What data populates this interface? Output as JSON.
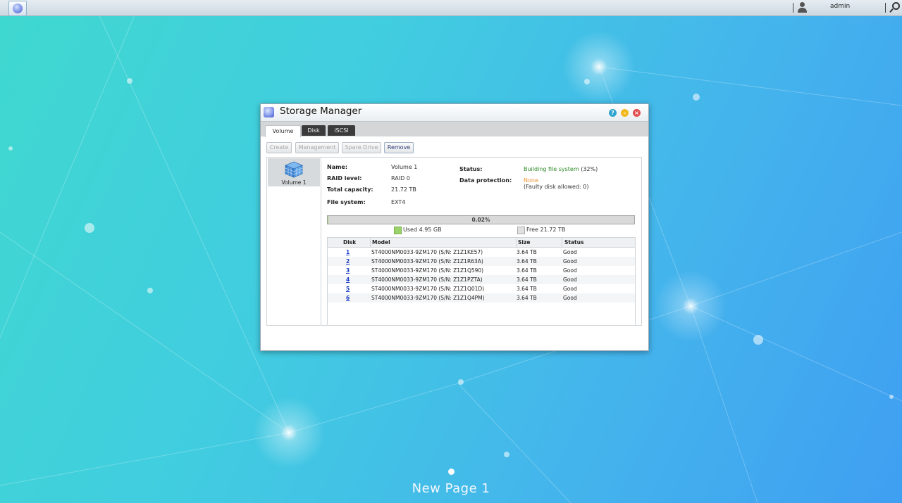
{
  "taskbar": {
    "username": "admin"
  },
  "window": {
    "title": "Storage Manager",
    "buttons": {
      "help": "?",
      "minimize": "–",
      "close": "×"
    },
    "tabs": [
      {
        "label": "Volume",
        "active": true
      },
      {
        "label": "Disk",
        "active": false
      },
      {
        "label": "iSCSI",
        "active": false
      }
    ],
    "toolbar": {
      "create": "Create",
      "management": "Management",
      "spare_drive": "Spare Drive",
      "remove": "Remove"
    },
    "volumes": [
      {
        "label": "Volume 1"
      }
    ],
    "details": {
      "name_label": "Name:",
      "name": "Volume 1",
      "raid_label": "RAID level:",
      "raid": "RAID 0",
      "capacity_label": "Total capacity:",
      "capacity": "21.72 TB",
      "fs_label": "File system:",
      "fs": "EXT4",
      "status_label": "Status:",
      "status": "Building file system",
      "status_pct": "(32%)",
      "protection_label": "Data protection:",
      "protection": "None",
      "protection_note": "(Faulty disk allowed: 0)"
    },
    "usage": {
      "percent_text": "0.02%",
      "used_fraction": 0.0002,
      "used": "Used 4.95 GB",
      "free": "Free 21.72 TB"
    },
    "disk_table": {
      "headers": [
        "Disk",
        "Model",
        "Size",
        "Status"
      ],
      "rows": [
        {
          "disk": "1",
          "model": "ST4000NM0033-9ZM170 (S/N: Z1Z1KE57)",
          "size": "3.64 TB",
          "status": "Good"
        },
        {
          "disk": "2",
          "model": "ST4000NM0033-9ZM170 (S/N: Z1Z1R63A)",
          "size": "3.64 TB",
          "status": "Good"
        },
        {
          "disk": "3",
          "model": "ST4000NM0033-9ZM170 (S/N: Z1Z1Q590)",
          "size": "3.64 TB",
          "status": "Good"
        },
        {
          "disk": "4",
          "model": "ST4000NM0033-9ZM170 (S/N: Z1Z1PZTA)",
          "size": "3.64 TB",
          "status": "Good"
        },
        {
          "disk": "5",
          "model": "ST4000NM0033-9ZM170 (S/N: Z1Z1Q01D)",
          "size": "3.64 TB",
          "status": "Good"
        },
        {
          "disk": "6",
          "model": "ST4000NM0033-9ZM170 (S/N: Z1Z1Q4PM)",
          "size": "3.64 TB",
          "status": "Good"
        }
      ]
    }
  },
  "desktop": {
    "page_label": "New Page 1"
  },
  "colors": {
    "status_green": "#2f8a2a",
    "protection_orange": "#f09030",
    "used_green": "#9cd26a",
    "link_blue": "#1a3cc8"
  },
  "icons": [
    "start-menu-icon",
    "user-icon",
    "search-icon",
    "app-icon",
    "help-icon",
    "minimize-icon",
    "close-icon",
    "volume-cube-icon"
  ]
}
